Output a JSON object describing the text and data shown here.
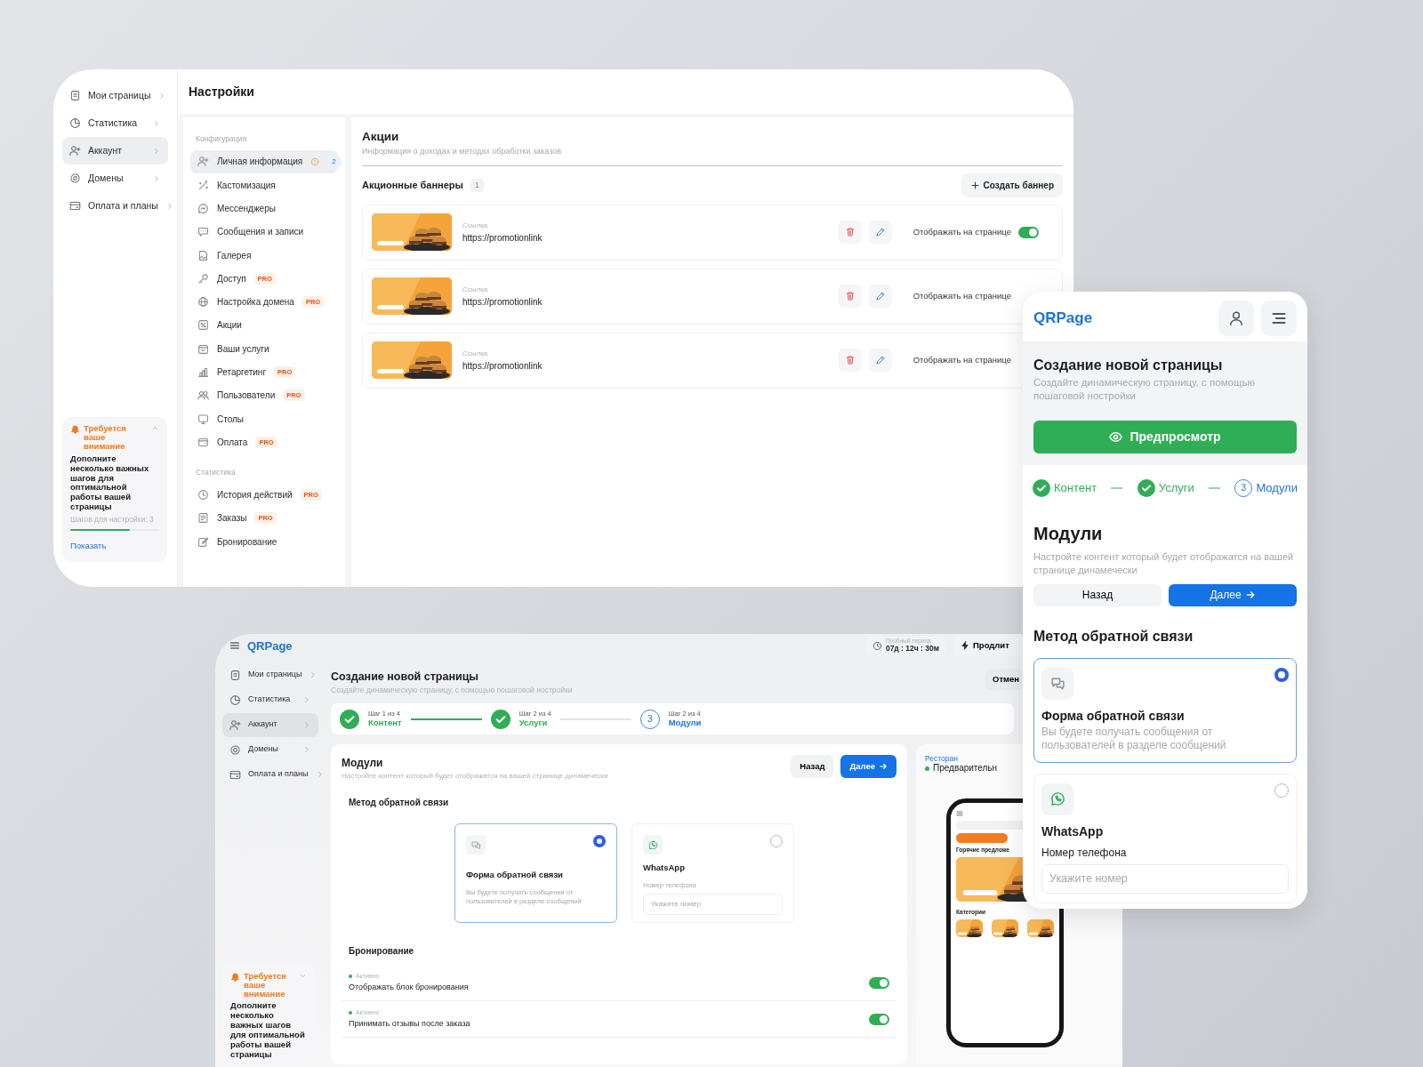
{
  "settings_window": {
    "nav": [
      {
        "label": "Мои страницы",
        "selected": false
      },
      {
        "label": "Статистика",
        "selected": false
      },
      {
        "label": "Аккаунт",
        "selected": true
      },
      {
        "label": "Домены",
        "selected": false
      },
      {
        "label": "Оплата и планы",
        "selected": false
      }
    ],
    "notice": {
      "title": "Требуется ваше внимание",
      "text": "Дополните несколько важных шагов для оптимальной работы вашей страницы",
      "steps": "Шагов для настройки: 3",
      "level": 0.67,
      "link": "Показать"
    },
    "title": "Настройки",
    "menu": [
      {
        "heading": "Конфигурация",
        "items": [
          {
            "label": "Личная информация",
            "selected": true,
            "alert": true,
            "count": "2"
          },
          {
            "label": "Кастомизация",
            "selected": false
          },
          {
            "label": "Мессенджеры",
            "selected": false
          },
          {
            "label": "Сообщения и записи",
            "selected": false
          },
          {
            "label": "Галерея",
            "selected": false
          },
          {
            "label": "Доступ",
            "selected": false,
            "badge": "PRO"
          },
          {
            "label": "Настройка домена",
            "selected": false,
            "badge": "PRO"
          },
          {
            "label": "Акции",
            "selected": false
          },
          {
            "label": "Ваши услуги",
            "selected": false
          },
          {
            "label": "Ретаргетинг",
            "selected": false,
            "badge": "PRO"
          },
          {
            "label": "Пользователи",
            "selected": false,
            "badge": "PRO"
          },
          {
            "label": "Столы",
            "selected": false
          },
          {
            "label": "Оплата",
            "selected": false,
            "badge": "PRO"
          }
        ]
      },
      {
        "heading": "Статистика",
        "items": [
          {
            "label": "История действий",
            "selected": false,
            "badge": "PRO"
          },
          {
            "label": "Заказы",
            "selected": false,
            "badge": "PRO"
          },
          {
            "label": "Бронирование",
            "selected": false
          }
        ]
      }
    ],
    "section": {
      "title": "Акции",
      "subtitle": "Информация о доходах и методах обработки заказов",
      "banners_title": "Акционные баннеры",
      "banners_count": "1",
      "create_button": "Создать баннер",
      "banners": [
        {
          "link_label": "Ссылка",
          "link": "https://promotionlink",
          "display_label": "Отображать на странице",
          "on": true
        },
        {
          "link_label": "Ссылка",
          "link": "https://promotionlink",
          "display_label": "Отображать на странице"
        },
        {
          "link_label": "Ссылка",
          "link": "https://promotionlink",
          "display_label": "Отображать на странице"
        }
      ]
    }
  },
  "builder_window": {
    "logo": "QRPage",
    "trial": {
      "label": "Пробный период",
      "time": "07д : 12ч : 30м"
    },
    "extend": "Продлит",
    "nav": [
      {
        "label": "Мои страницы",
        "selected": false
      },
      {
        "label": "Статистика",
        "selected": false
      },
      {
        "label": "Аккаунт",
        "selected": true
      },
      {
        "label": "Домены",
        "selected": false
      },
      {
        "label": "Оплата и планы",
        "selected": false
      }
    ],
    "notice": {
      "title": "Требуется ваше внимание",
      "text": "Дополните несколько важных шагов для оптимальной работы вашей страницы"
    },
    "title": "Создание новой страницы",
    "subtitle": "Создайте динамическую страницу, с помощью пошаговой ностройки",
    "cancel": "Отмен",
    "steps": [
      {
        "caption": "Шаг 1 из 4",
        "label": "Контент",
        "done": true
      },
      {
        "caption": "Шаг 2 из 4",
        "label": "Услуги",
        "done": true
      },
      {
        "caption": "Шаг 2 из 4",
        "label": "Модули",
        "done": false,
        "number": "3"
      }
    ],
    "module": {
      "title": "Модули",
      "subtitle": "Настройте контент который будет отображатся на вашей странице динамечески",
      "back": "Назад",
      "next": "Далее",
      "feedback_title": "Метод обратной связи",
      "options": [
        {
          "kind": "form",
          "title": "Форма обратной связи",
          "text": "Вы будете получать сообщения от пользователей в разделе сообщений",
          "selected": true
        },
        {
          "kind": "whatsapp",
          "title": "WhatsApp",
          "field_label": "Номер телефона",
          "placeholder": "Укажите номер",
          "selected": false
        }
      ],
      "booking_title": "Бронирование",
      "booking": [
        {
          "status": "Активно",
          "label": "Отображать блок бронирования",
          "on": true
        },
        {
          "status": "Активно",
          "label": "Принимать отзывы после заказа",
          "on": true
        }
      ]
    },
    "preview": {
      "category": "Ресторан",
      "status": "Предварительн",
      "phone": {
        "hot": "Горячие предложе",
        "categories": "Категории"
      }
    }
  },
  "mobile": {
    "logo": "QRPage",
    "title": "Создание новой страницы",
    "subtitle": "Создайте динамическую страницу, с помощью пошаговой ностройки",
    "preview_button": "Предпросмотр",
    "steps": [
      {
        "label": "Контент",
        "done": true
      },
      {
        "label": "Услуги",
        "done": true
      },
      {
        "label": "Модули",
        "done": false,
        "number": "3"
      }
    ],
    "module": {
      "title": "Модули",
      "subtitle": "Настройте контент который будет отображатся на вашей странице динамечески",
      "back": "Назад",
      "next": "Далее",
      "feedback_title": "Метод обратной связи",
      "options": [
        {
          "kind": "form",
          "title": "Форма обратной связи",
          "text": "Вы будете получать сообщения от пользователей в разделе сообщений",
          "selected": true
        },
        {
          "kind": "whatsapp",
          "title": "WhatsApp",
          "field_label": "Номер телефона",
          "placeholder": "Укажите номер",
          "selected": false
        }
      ]
    }
  }
}
